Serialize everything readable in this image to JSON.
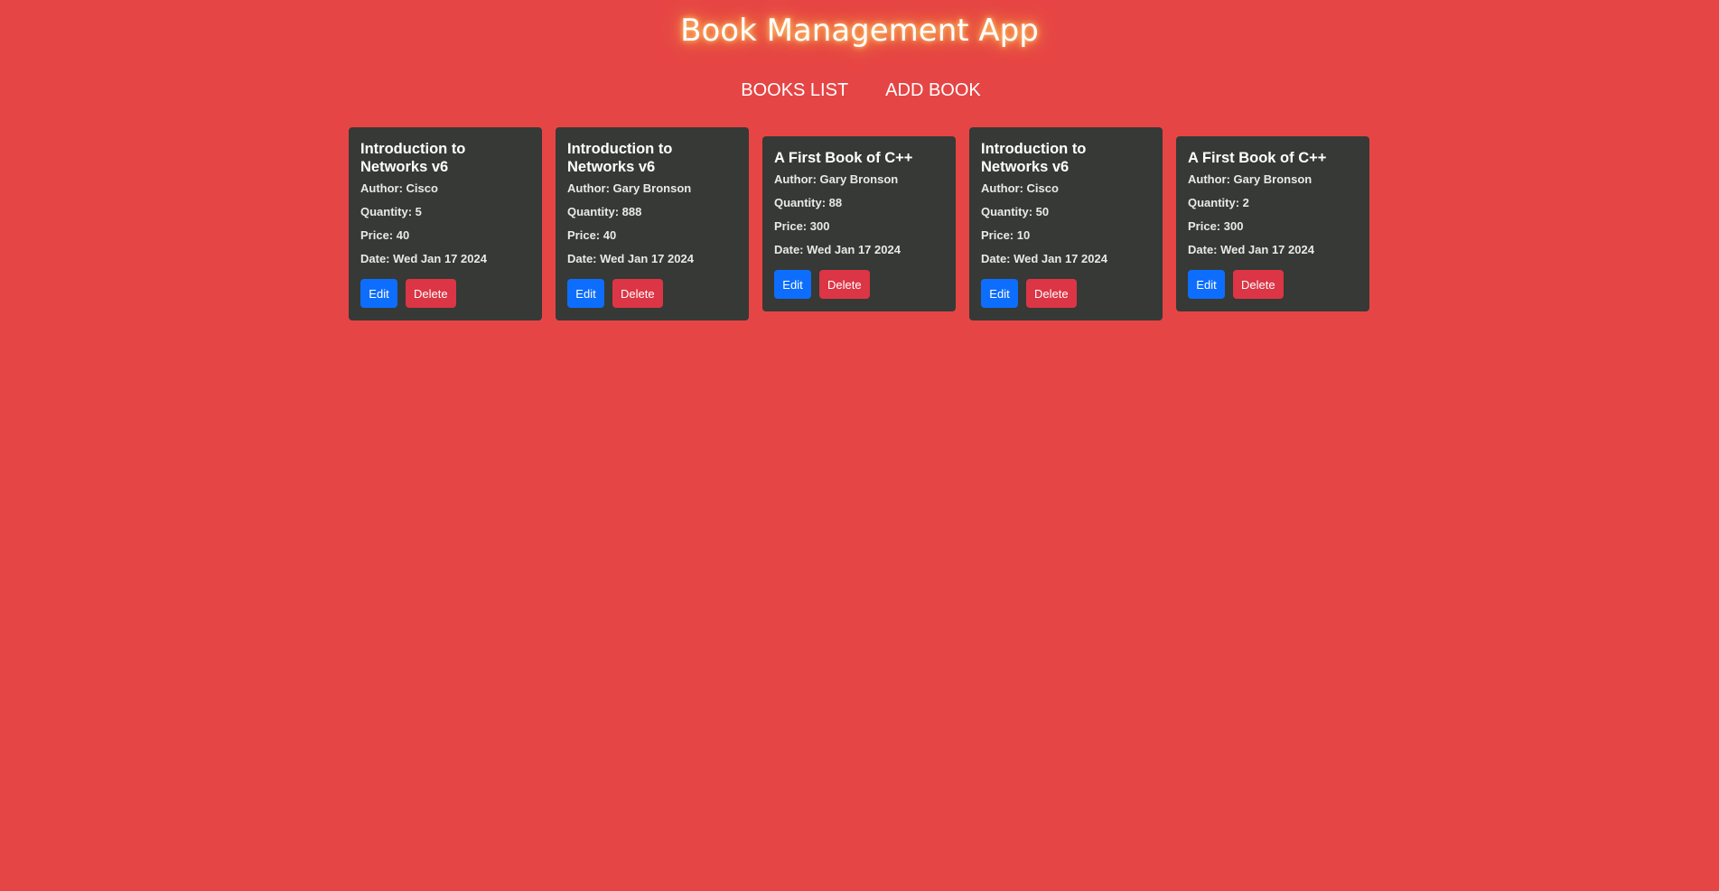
{
  "app": {
    "title": "Book Management App"
  },
  "nav": {
    "books_list": "BOOKS LIST",
    "add_book": "ADD BOOK"
  },
  "colors": {
    "background": "#e64545",
    "card": "#363936",
    "edit_button": "#0d6efd",
    "delete_button": "#dc3545"
  },
  "books": [
    {
      "title": "Introduction to Networks v6",
      "author": "Author: Cisco",
      "quantity": "Quantity: 5",
      "price": "Price: 40",
      "date": "Date: Wed Jan 17 2024",
      "edit_label": "Edit",
      "delete_label": "Delete"
    },
    {
      "title": "Introduction to Networks v6",
      "author": "Author: Gary Bronson",
      "quantity": "Quantity: 888",
      "price": "Price: 40",
      "date": "Date: Wed Jan 17 2024",
      "edit_label": "Edit",
      "delete_label": "Delete"
    },
    {
      "title": "A First Book of C++",
      "author": "Author: Gary Bronson",
      "quantity": "Quantity: 88",
      "price": "Price: 300",
      "date": "Date: Wed Jan 17 2024",
      "edit_label": "Edit",
      "delete_label": "Delete"
    },
    {
      "title": "Introduction to Networks v6",
      "author": "Author: Cisco",
      "quantity": "Quantity: 50",
      "price": "Price: 10",
      "date": "Date: Wed Jan 17 2024",
      "edit_label": "Edit",
      "delete_label": "Delete"
    },
    {
      "title": "A First Book of C++",
      "author": "Author: Gary Bronson",
      "quantity": "Quantity: 2",
      "price": "Price: 300",
      "date": "Date: Wed Jan 17 2024",
      "edit_label": "Edit",
      "delete_label": "Delete"
    }
  ]
}
